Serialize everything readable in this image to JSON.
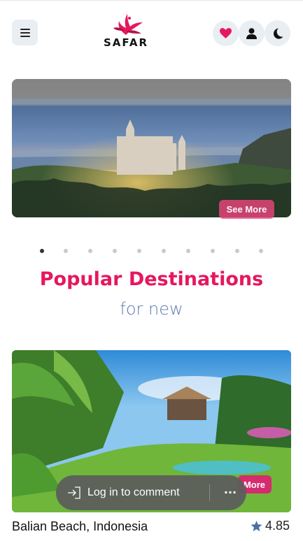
{
  "header": {
    "logo_text": "SAFAR",
    "icons": {
      "menu": "hamburger-menu-icon",
      "favorite": "heart-icon",
      "user": "user-icon",
      "theme": "moon-icon"
    },
    "colors": {
      "brand": "#e6175f",
      "button_bg": "#e9eef3"
    }
  },
  "carousel": {
    "see_more_label": "See More",
    "slide_count": 10,
    "active_slide": 1
  },
  "section": {
    "title": "Popular Destinations",
    "subtitle": "for new"
  },
  "card": {
    "title": "Balian Beach, Indonesia",
    "rating": "4.85",
    "more_label": "More",
    "rating_icon": "star-icon"
  },
  "overlay": {
    "login_label": "Log in to comment",
    "more_icon": "ellipsis-icon",
    "login_icon": "sign-in-icon"
  }
}
